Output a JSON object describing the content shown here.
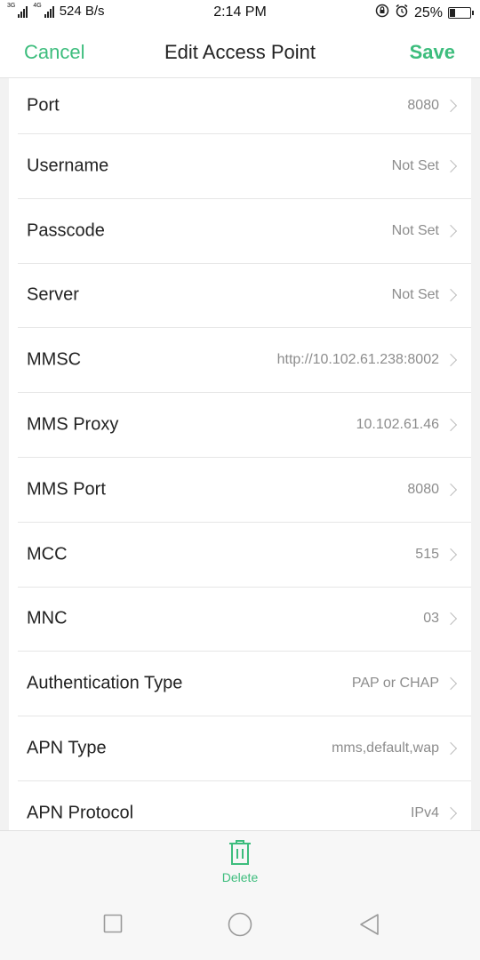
{
  "status_bar": {
    "network_type": "3G",
    "network_type2": "4G",
    "speed": "524 B/s",
    "time": "2:14 PM",
    "battery": "25%",
    "battery_level": 0.25
  },
  "header": {
    "cancel_label": "Cancel",
    "title": "Edit Access Point",
    "save_label": "Save"
  },
  "rows": [
    {
      "label": "Port",
      "value": "8080"
    },
    {
      "label": "Username",
      "value": "Not Set"
    },
    {
      "label": "Passcode",
      "value": "Not Set"
    },
    {
      "label": "Server",
      "value": "Not Set"
    },
    {
      "label": "MMSC",
      "value": "http://10.102.61.238:8002"
    },
    {
      "label": "MMS Proxy",
      "value": "10.102.61.46"
    },
    {
      "label": "MMS Port",
      "value": "8080"
    },
    {
      "label": "MCC",
      "value": "515"
    },
    {
      "label": "MNC",
      "value": "03"
    },
    {
      "label": "Authentication Type",
      "value": "PAP or CHAP"
    },
    {
      "label": "APN Type",
      "value": "mms,default,wap"
    },
    {
      "label": "APN Protocol",
      "value": "IPv4"
    }
  ],
  "bottom": {
    "delete_label": "Delete",
    "delete_icon": "trash-icon"
  },
  "nav": {
    "recents_icon": "square-icon",
    "home_icon": "circle-icon",
    "back_icon": "triangle-back-icon"
  },
  "colors": {
    "accent": "#3dbd7d",
    "value_text": "#8c8c8c"
  }
}
